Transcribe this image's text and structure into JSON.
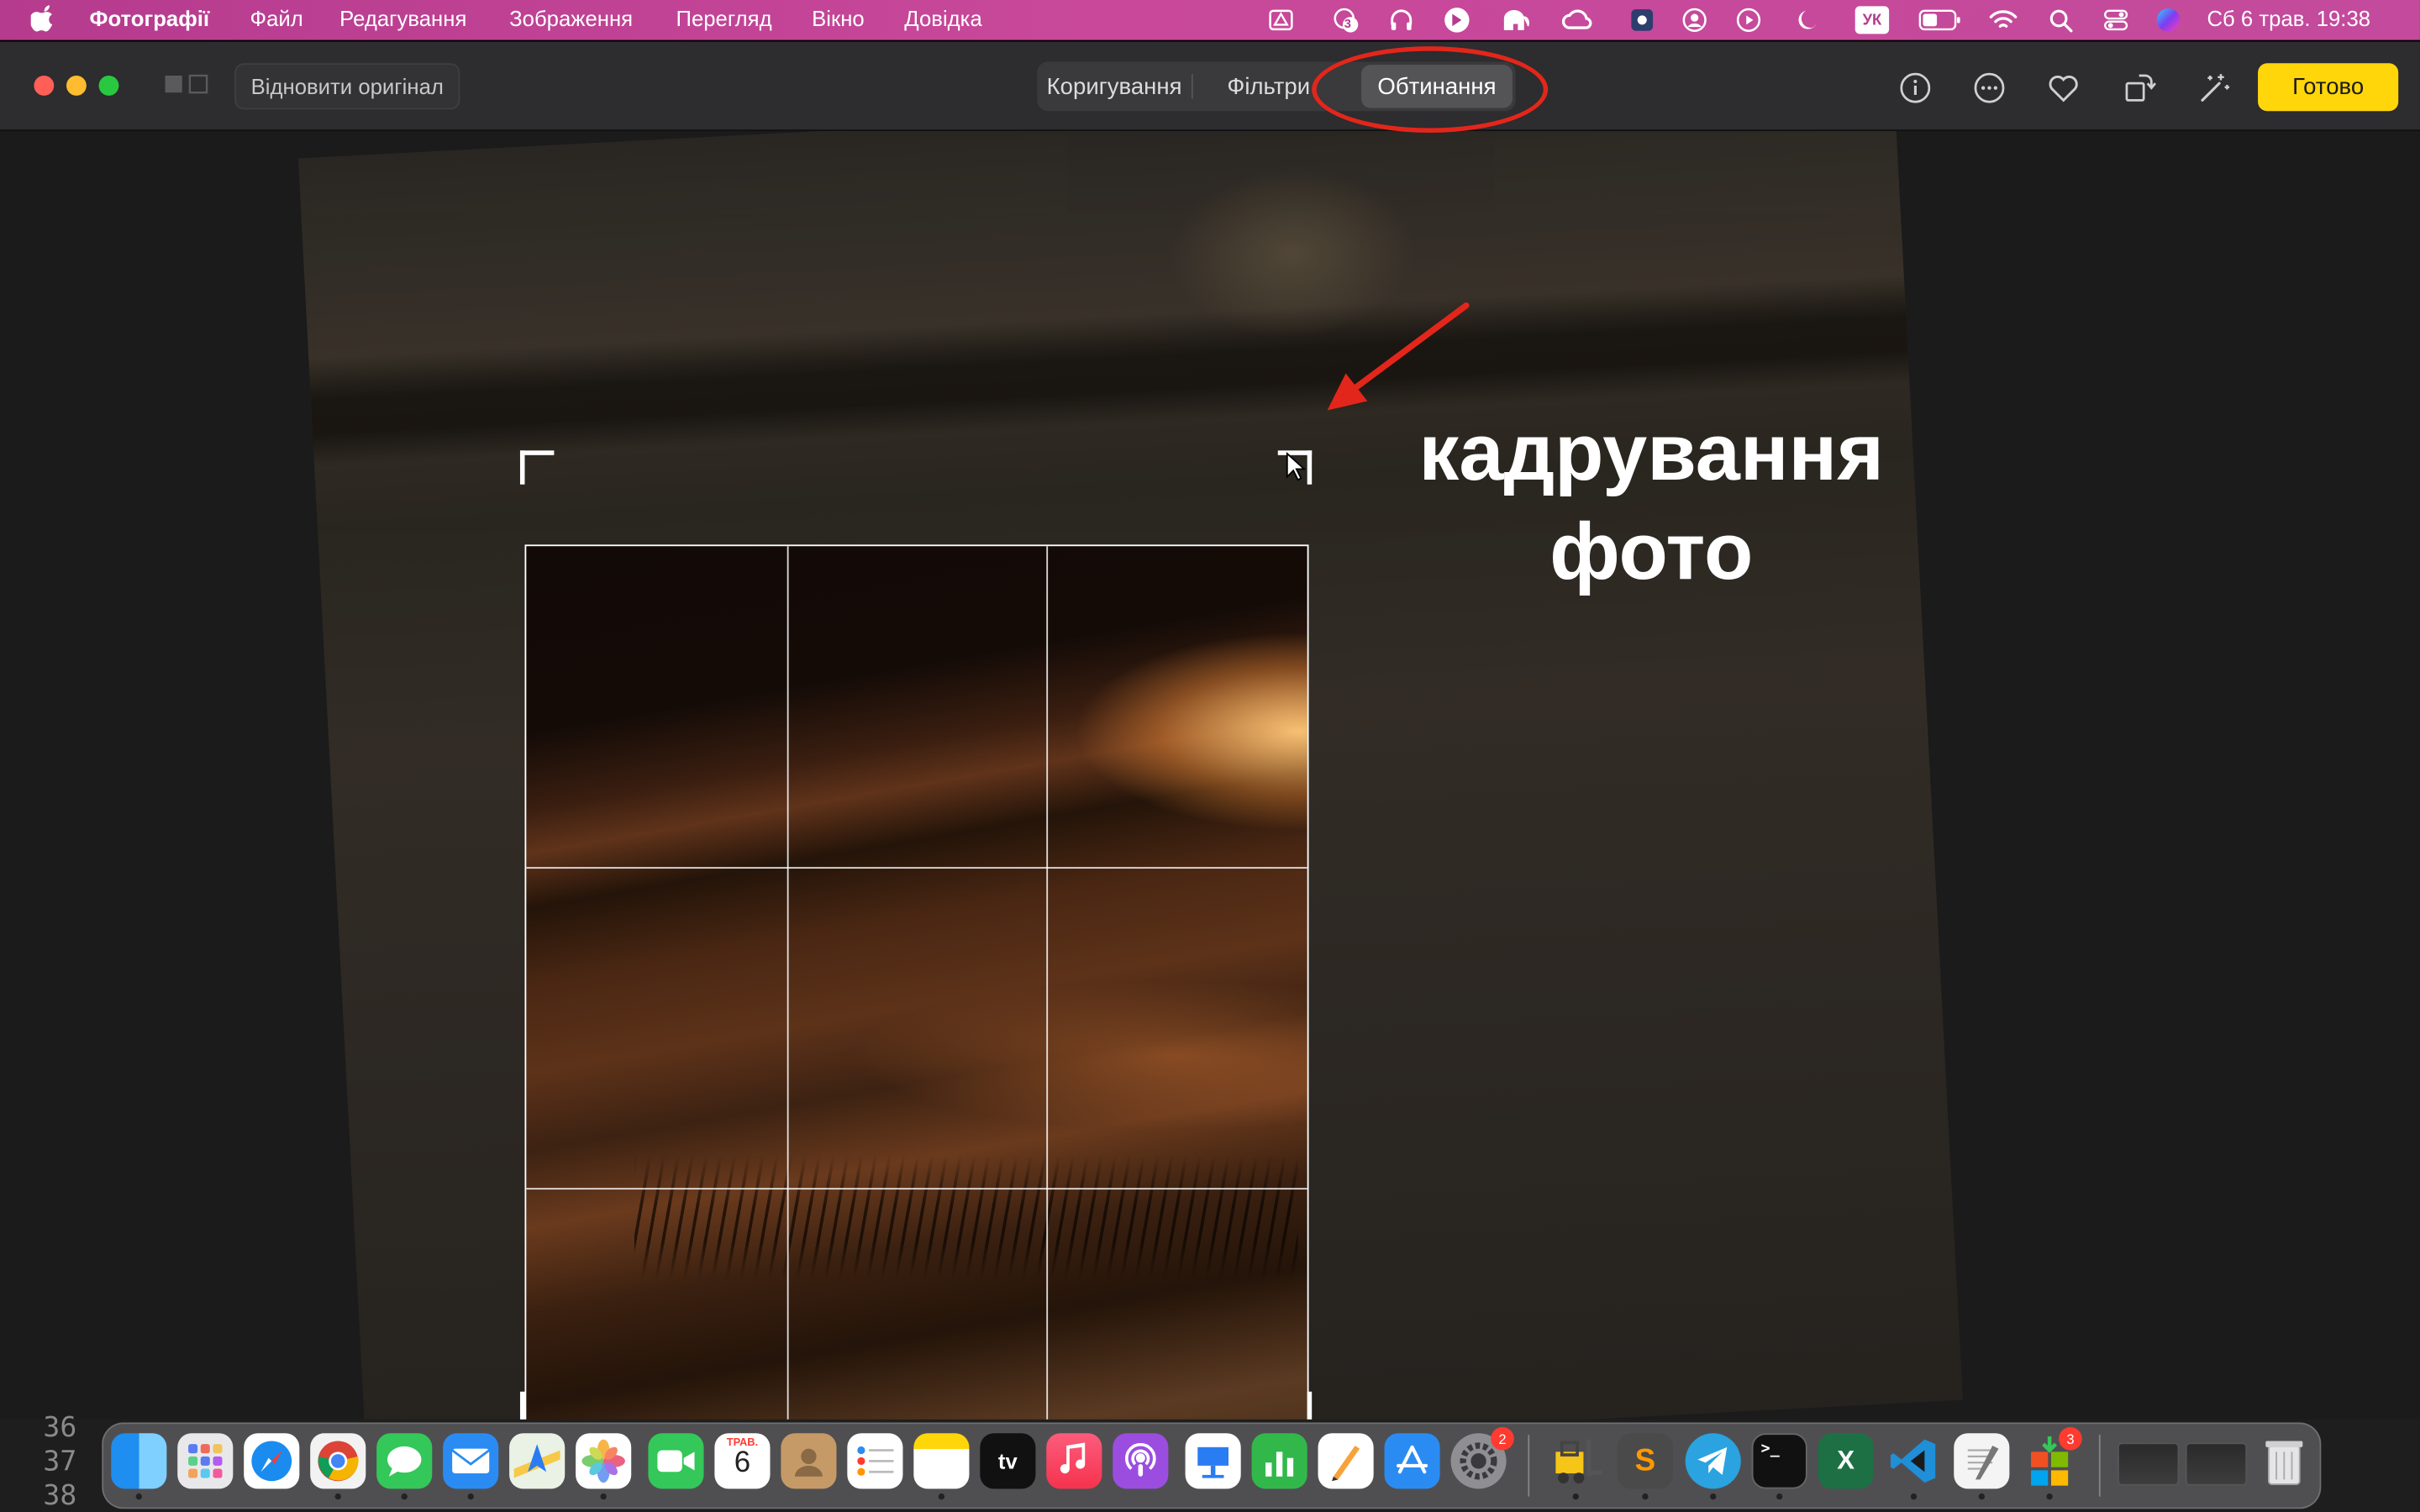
{
  "menubar": {
    "app_name": "Фотографії",
    "items": [
      "Файл",
      "Редагування",
      "Зображення",
      "Перегляд",
      "Вікно",
      "Довідка"
    ],
    "tray_badge": "3",
    "input_source": "УК",
    "datetime": "Сб 6 трав.  19:38"
  },
  "toolbar": {
    "revert_label": "Відновити оригінал",
    "tabs": [
      "Коригування",
      "Фільтри",
      "Обтинання"
    ],
    "active_tab": "Обтинання",
    "done_label": "Готово"
  },
  "overlay": {
    "caption_line1": "кадрування",
    "caption_line2": "фото"
  },
  "dock": {
    "calendar_month": "ТРАВ.",
    "calendar_day": "6",
    "settings_badge": "2",
    "app_badge": "3",
    "excel_letter": "X",
    "terminal_prompt": ">_",
    "tv_label": "tv",
    "sublime_letter": "S"
  },
  "background_code": {
    "lines": [
      "36",
      "37",
      "38"
    ]
  },
  "colors": {
    "menubar": "#c3439a",
    "done_button": "#ffd60a",
    "annotation_red": "#e3261b"
  }
}
